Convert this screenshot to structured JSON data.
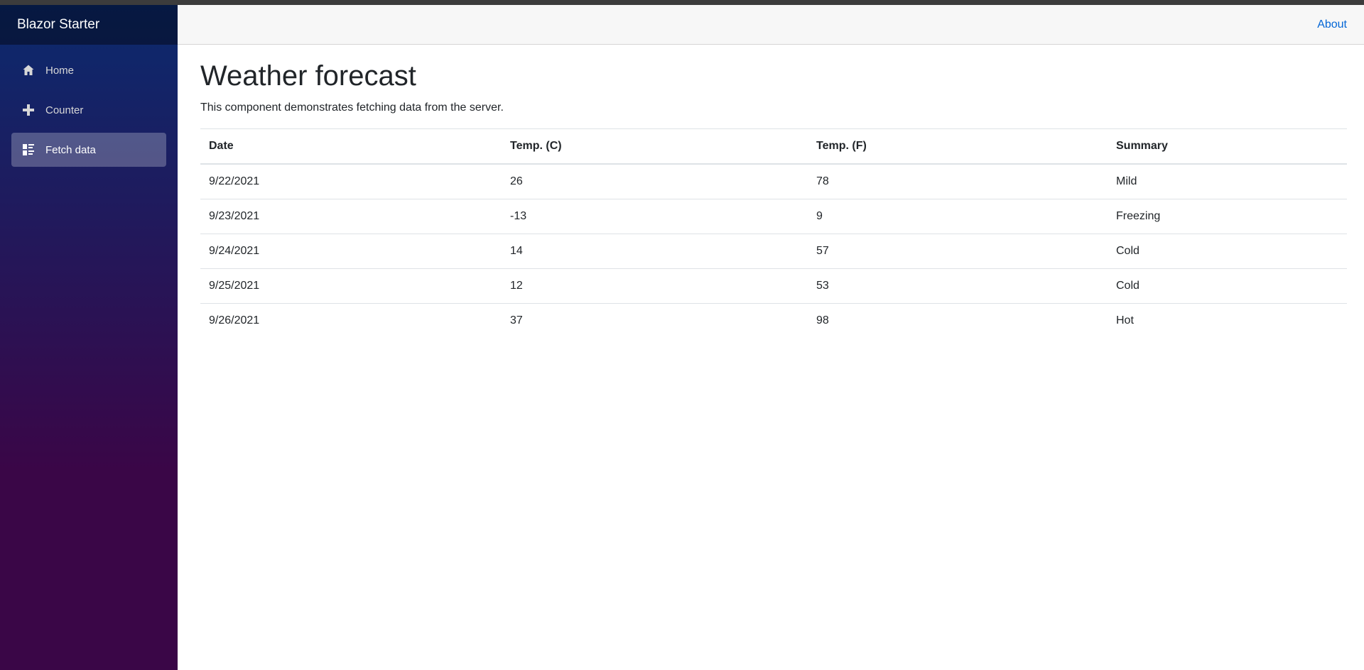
{
  "app": {
    "brand": "Blazor Starter"
  },
  "nav": {
    "items": [
      {
        "label": "Home",
        "icon": "home-icon",
        "active": false
      },
      {
        "label": "Counter",
        "icon": "plus-icon",
        "active": false
      },
      {
        "label": "Fetch data",
        "icon": "list-rich-icon",
        "active": true
      }
    ]
  },
  "top_row": {
    "about_label": "About"
  },
  "page": {
    "title": "Weather forecast",
    "description": "This component demonstrates fetching data from the server."
  },
  "table": {
    "headers": [
      "Date",
      "Temp. (C)",
      "Temp. (F)",
      "Summary"
    ],
    "rows": [
      [
        "9/22/2021",
        "26",
        "78",
        "Mild"
      ],
      [
        "9/23/2021",
        "-13",
        "9",
        "Freezing"
      ],
      [
        "9/24/2021",
        "14",
        "57",
        "Cold"
      ],
      [
        "9/25/2021",
        "12",
        "53",
        "Cold"
      ],
      [
        "9/26/2021",
        "37",
        "98",
        "Hot"
      ]
    ]
  },
  "colors": {
    "sidebar_top": "#0b2a6e",
    "sidebar_bottom": "#3a0647",
    "link": "#0366d6",
    "top_row_bg": "#f7f7f7"
  }
}
